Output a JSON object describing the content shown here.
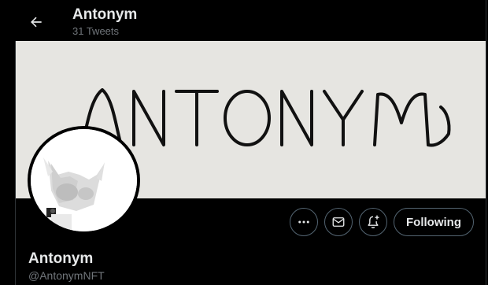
{
  "header": {
    "name": "Antonym",
    "tweet_count": "31 Tweets"
  },
  "banner": {
    "wordmark": "ANTONYM"
  },
  "actions": {
    "following_label": "Following"
  },
  "profile": {
    "name": "Antonym",
    "handle": "@AntonymNFT"
  },
  "icons": [
    "arrow-left-icon",
    "more-icon",
    "mail-icon",
    "bell-plus-icon"
  ],
  "colors": {
    "background": "#000000",
    "banner": "#e6e5e1",
    "text_primary": "#e7e9ea",
    "text_secondary": "#71767b",
    "button_border": "#536471"
  }
}
